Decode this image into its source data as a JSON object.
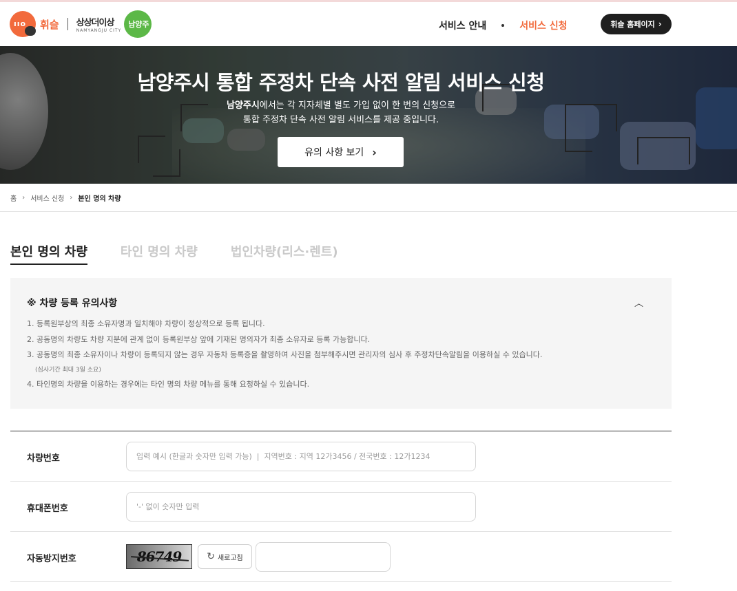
{
  "header": {
    "brand_name": "휘슬",
    "city_slogan": "상상더이상",
    "city_sub": "NAMYANGJU CITY",
    "city_badge": "남양주",
    "nav": [
      {
        "label": "서비스 안내",
        "active": false
      },
      {
        "label": "서비스 신청",
        "active": true
      }
    ],
    "home_button": "휘슬 홈페이지",
    "accent_color": "#f26a3c"
  },
  "hero": {
    "title": "남양주시 통합 주정차 단속 사전 알림 서비스 신청",
    "desc_strong": "남양주시",
    "desc_line1_rest": "에서는 각 지자체별 별도 가입 없이 한 번의 신청으로",
    "desc_line2": "통합 주정차 단속 사전 알림 서비스를 제공 중입니다.",
    "button": "유의 사항 보기"
  },
  "breadcrumb": [
    "홈",
    "서비스 신청",
    "본인 명의 차량"
  ],
  "tabs": [
    {
      "label": "본인 명의 차량",
      "active": true
    },
    {
      "label": "타인 명의 차량",
      "active": false
    },
    {
      "label": "법인차량(리스·렌트)",
      "active": false
    }
  ],
  "notice": {
    "title": "※ 차량 등록 유의사항",
    "items": [
      "1. 등록원부상의 최종 소유자명과 일치해야 차량이 정상적으로 등록 됩니다.",
      "2. 공동명의 차량도 차량 지분에 관계 없이 등록원부상 앞에 기재된 명의자가 최종 소유자로 등록 가능합니다.",
      "3. 공동명의 최종 소유자이나 차량이 등록되지 않는 경우 자동차 등록증을 촬영하여 사진을 첨부해주시면 관리자의 심사 후 주정차단속알림을 이용하실 수 있습니다.",
      "(심사기간 최대 3일 소요)",
      "4. 타인명의 차량을 이용하는 경우에는 타인 명의 차량 메뉴를 통해 요청하실 수 있습니다."
    ]
  },
  "form": {
    "vehicle": {
      "label": "차량번호",
      "value": "",
      "placeholder": "입력 예시 (한글과 숫자만 입력 가능)  |  지역번호 : 지역 12가3456 / 전국번호 : 12가1234"
    },
    "phone": {
      "label": "휴대폰번호",
      "value": "",
      "placeholder": "'-' 없이 숫자만 입력"
    },
    "captcha": {
      "label": "자동방지번호",
      "code": "86749",
      "refresh_label": "새로고침",
      "value": ""
    }
  }
}
